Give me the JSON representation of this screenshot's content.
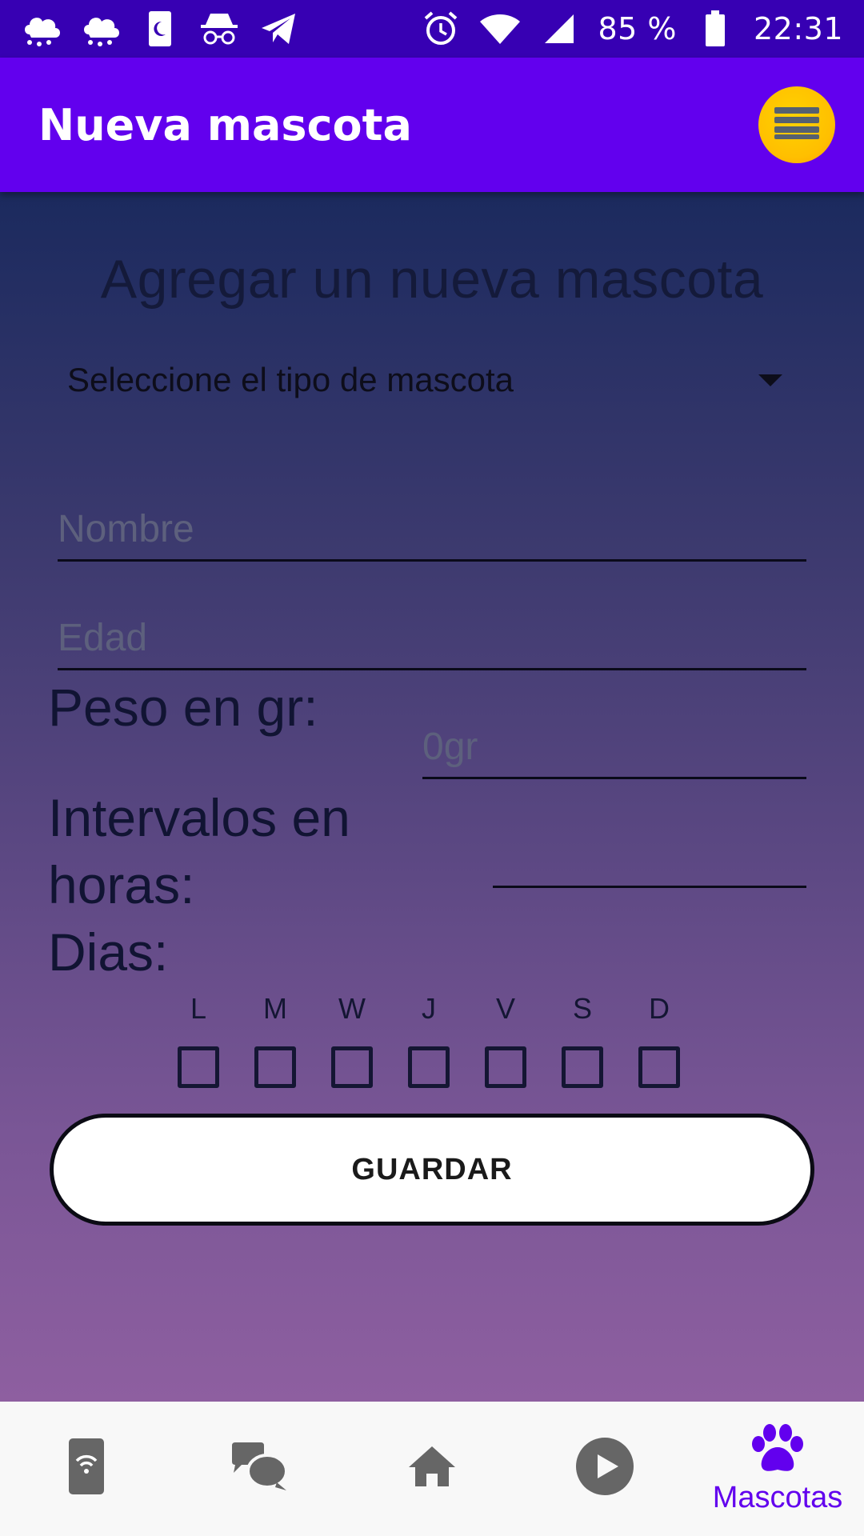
{
  "status_bar": {
    "battery_percent": "85 %",
    "time": "22:31",
    "icons": [
      "weather-icon",
      "weather-icon-2",
      "sim-night-icon",
      "incognito-icon",
      "telegram-icon",
      "alarm-icon",
      "wifi-icon",
      "signal-icon",
      "battery-icon"
    ]
  },
  "app_bar": {
    "title": "Nueva mascota",
    "menu_icon": "list-icon",
    "menu_color": "#ffc400"
  },
  "form": {
    "heading": "Agregar un nueva mascota",
    "pet_type": {
      "selected": "Seleccione el tipo de mascota"
    },
    "name": {
      "placeholder": "Nombre",
      "value": ""
    },
    "age": {
      "placeholder": "Edad",
      "value": ""
    },
    "weight": {
      "label": "Peso en gr:",
      "placeholder": "0gr",
      "value": ""
    },
    "interval": {
      "label": "Intervalos en horas:",
      "value": ""
    },
    "days": {
      "label": "Dias:",
      "items": [
        {
          "label": "L",
          "checked": false
        },
        {
          "label": "M",
          "checked": false
        },
        {
          "label": "W",
          "checked": false
        },
        {
          "label": "J",
          "checked": false
        },
        {
          "label": "V",
          "checked": false
        },
        {
          "label": "S",
          "checked": false
        },
        {
          "label": "D",
          "checked": false
        }
      ]
    },
    "save_label": "GUARDAR"
  },
  "bottom_nav": {
    "items": [
      {
        "icon": "phone-wifi-icon",
        "label": ""
      },
      {
        "icon": "chat-icon",
        "label": ""
      },
      {
        "icon": "home-icon",
        "label": ""
      },
      {
        "icon": "play-icon",
        "label": ""
      },
      {
        "icon": "paw-icon",
        "label": "Mascotas",
        "active": true
      }
    ]
  },
  "colors": {
    "primary": "#6200ee",
    "primary_dark": "#3700b3",
    "accent": "#ffc400"
  }
}
